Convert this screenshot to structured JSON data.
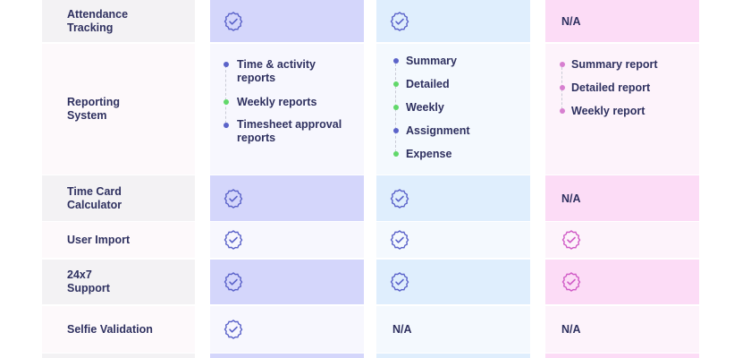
{
  "colors": {
    "plan1_icon": "#5b63c9",
    "plan2_icon": "#5b63c9",
    "plan3_icon": "#d05bc6",
    "dot_blue": "#5b63c9",
    "dot_green": "#61d86a",
    "dot_pink": "#d77fd0"
  },
  "rows": [
    {
      "feature": "Attendance\nTracking",
      "c1": {
        "type": "check"
      },
      "c2": {
        "type": "check"
      },
      "c3": {
        "type": "na",
        "text": "N/A"
      }
    },
    {
      "feature": "Reporting\nSystem",
      "c1": {
        "type": "list",
        "items": [
          {
            "text": "Time & activity\nreports",
            "dot": "blue"
          },
          {
            "text": "Weekly reports",
            "dot": "green"
          },
          {
            "text": "Timesheet approval\nreports",
            "dot": "blue"
          }
        ]
      },
      "c2": {
        "type": "list",
        "items": [
          {
            "text": "Summary",
            "dot": "blue"
          },
          {
            "text": "Detailed",
            "dot": "green"
          },
          {
            "text": "Weekly",
            "dot": "green"
          },
          {
            "text": "Assignment",
            "dot": "blue"
          },
          {
            "text": "Expense",
            "dot": "green"
          }
        ]
      },
      "c3": {
        "type": "list",
        "items": [
          {
            "text": "Summary report",
            "dot": "pink"
          },
          {
            "text": "Detailed report",
            "dot": "pink"
          },
          {
            "text": "Weekly report",
            "dot": "pink"
          }
        ]
      }
    },
    {
      "feature": "Time Card\nCalculator",
      "c1": {
        "type": "check"
      },
      "c2": {
        "type": "check"
      },
      "c3": {
        "type": "na",
        "text": "N/A"
      }
    },
    {
      "feature": "User Import",
      "c1": {
        "type": "check"
      },
      "c2": {
        "type": "check"
      },
      "c3": {
        "type": "check"
      }
    },
    {
      "feature": "24x7\nSupport",
      "c1": {
        "type": "check"
      },
      "c2": {
        "type": "check"
      },
      "c3": {
        "type": "check"
      }
    },
    {
      "feature": "Selfie Validation",
      "c1": {
        "type": "check"
      },
      "c2": {
        "type": "na",
        "text": "N/A"
      },
      "c3": {
        "type": "na",
        "text": "N/A"
      }
    }
  ]
}
